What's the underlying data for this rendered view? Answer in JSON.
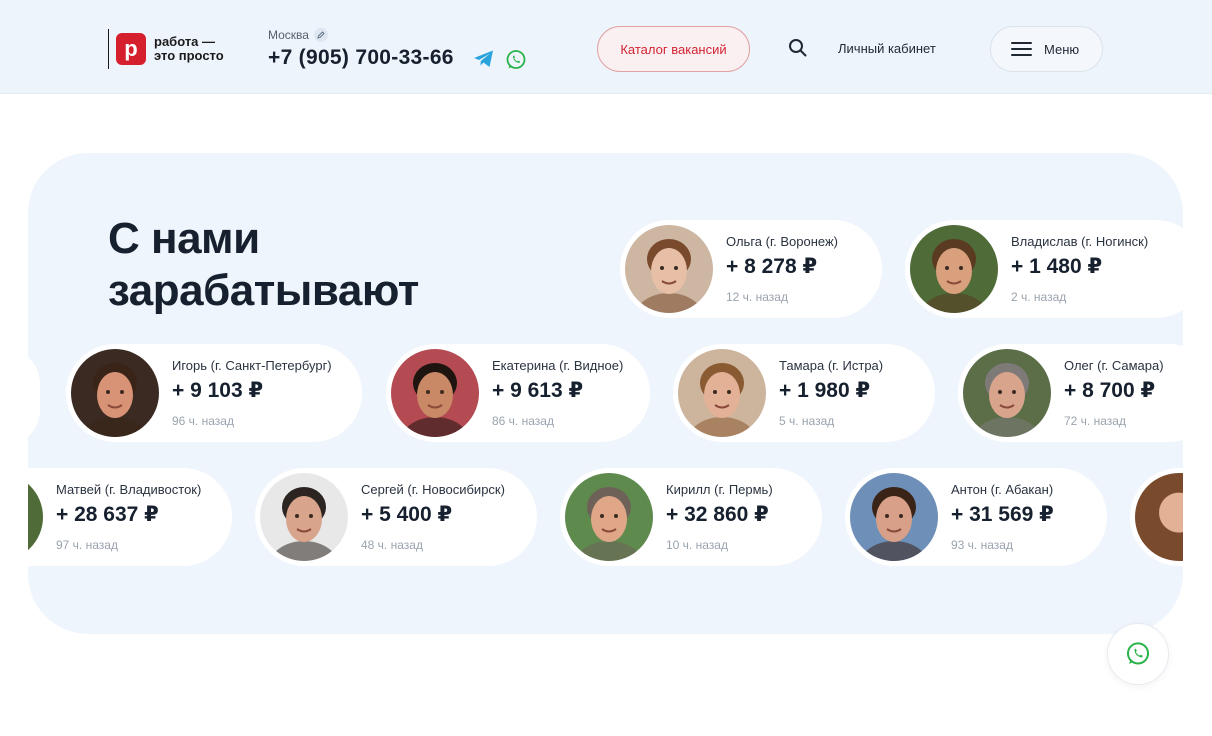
{
  "header": {
    "logo_mark": "р",
    "logo_line1": "работа —",
    "logo_line2": "это просто",
    "city": "Москва",
    "phone": "+7 (905) 700-33-66",
    "catalog_label": "Каталог вакансий",
    "cabinet_label": "Личный кабинет",
    "menu_label": "Меню"
  },
  "section": {
    "title_line1": "С нами",
    "title_line2": "зарабатывают"
  },
  "cards": [
    {
      "name": "Ольга (г. Воронеж)",
      "amount": "+ 8 278 ₽",
      "time": "12 ч. назад",
      "skin": "#e6bfa6",
      "hair": "#7a4a2c",
      "bg": "#cdb6a2"
    },
    {
      "name": "Владислав (г. Ногинск)",
      "amount": "+ 1 480 ₽",
      "time": "2 ч. назад",
      "skin": "#d9a07e",
      "hair": "#5a3b22",
      "bg": "#4f6b37"
    },
    {
      "name": "Игорь (г. Санкт-Петербург)",
      "amount": "+ 9 103 ₽",
      "time": "96 ч. назад",
      "skin": "#d89377",
      "hair": "#3a2418",
      "bg": "#3b2a22"
    },
    {
      "name": "Екатерина (г. Видное)",
      "amount": "+ 9 613 ₽",
      "time": "86 ч. назад",
      "skin": "#c98866",
      "hair": "#1e1410",
      "bg": "#b44a52"
    },
    {
      "name": "Тамара (г. Истра)",
      "amount": "+ 1 980 ₽",
      "time": "5 ч. назад",
      "skin": "#e2b196",
      "hair": "#8a5a32",
      "bg": "#cdb49c"
    },
    {
      "name": "Олег (г. Самара)",
      "amount": "+ 8 700 ₽",
      "time": "72 ч. назад",
      "skin": "#d8a48c",
      "hair": "#7d7a78",
      "bg": "#5c6e48"
    },
    {
      "name": "Матвей (г. Владивосток)",
      "amount": "+ 28 637 ₽",
      "time": "97 ч. назад",
      "skin": "#d9a07e",
      "hair": "#4a3020",
      "bg": "#4f6b37"
    },
    {
      "name": "Сергей (г. Новосибирск)",
      "amount": "+ 5 400 ₽",
      "time": "48 ч. назад",
      "skin": "#d8a48c",
      "hair": "#2c2420",
      "bg": "#e8e8e8"
    },
    {
      "name": "Кирилл (г. Пермь)",
      "amount": "+ 32 860 ₽",
      "time": "10 ч. назад",
      "skin": "#dfa688",
      "hair": "#6e6258",
      "bg": "#5f8a4e"
    },
    {
      "name": "Антон (г. Абакан)",
      "amount": "+ 31 569 ₽",
      "time": "93 ч. назад",
      "skin": "#d8a088",
      "hair": "#3a2418",
      "bg": "#6d8fb8"
    }
  ],
  "colors": {
    "brand_red": "#d61f2c",
    "panel_bg": "#eff5fc",
    "whatsapp_green": "#29b34a",
    "telegram_blue": "#2aa3dc"
  },
  "icons": [
    "pencil-icon",
    "telegram-icon",
    "whatsapp-icon",
    "search-icon",
    "menu-icon"
  ]
}
